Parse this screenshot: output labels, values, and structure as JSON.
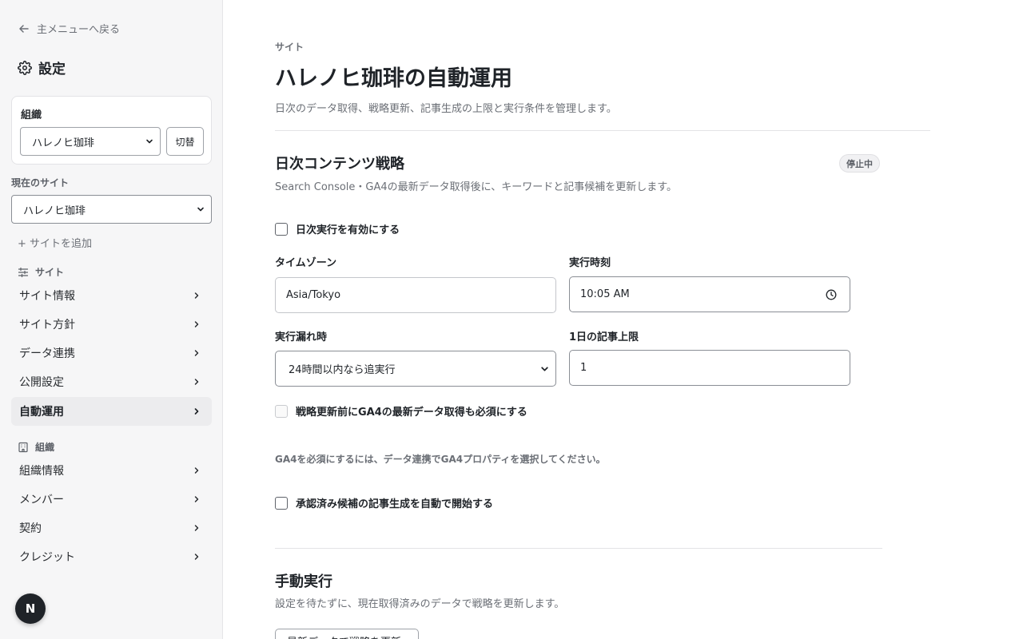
{
  "sidebar": {
    "back_label": "主メニューへ戻る",
    "settings_title": "設定",
    "org_label": "組織",
    "org_selected": "ハレノヒ珈琲",
    "switch_label": "切替",
    "current_site_label": "現在のサイト",
    "site_selected": "ハレノヒ珈琲",
    "add_site_label": "+ サイトを追加",
    "site_section_label": "サイト",
    "site_items": [
      {
        "label": "サイト情報"
      },
      {
        "label": "サイト方針"
      },
      {
        "label": "データ連携"
      },
      {
        "label": "公開設定"
      },
      {
        "label": "自動運用"
      }
    ],
    "org_section_label": "組織",
    "org_items": [
      {
        "label": "組織情報"
      },
      {
        "label": "メンバー"
      },
      {
        "label": "契約"
      },
      {
        "label": "クレジット"
      }
    ],
    "avatar_initial": "N"
  },
  "main": {
    "eyebrow": "サイト",
    "title": "ハレノヒ珈琲の自動運用",
    "description": "日次のデータ取得、戦略更新、記事生成の上限と実行条件を管理します。",
    "daily": {
      "title": "日次コンテンツ戦略",
      "description": "Search Console・GA4の最新データ取得後に、キーワードと記事候補を更新します。",
      "status_badge": "停止中",
      "enable_label": "日次実行を有効にする",
      "timezone_label": "タイムゾーン",
      "timezone_value": "Asia/Tokyo",
      "run_time_label": "実行時刻",
      "run_time_value": "10:05 AM",
      "missed_label": "実行漏れ時",
      "missed_value": "24時間以内なら追実行",
      "daily_limit_label": "1日の記事上限",
      "daily_limit_value": "1",
      "ga4_required_label": "戦略更新前にGA4の最新データ取得も必須にする",
      "ga4_hint": "GA4を必須にするには、データ連携でGA4プロパティを選択してください。",
      "auto_generate_label": "承認済み候補の記事生成を自動で開始する"
    },
    "manual": {
      "title": "手動実行",
      "description": "設定を待たずに、現在取得済みのデータで戦略を更新します。",
      "button_label": "最新データで戦略を更新"
    }
  },
  "colors": {
    "sidebar_bg": "#f6f6f7",
    "active_item_bg": "#ececee",
    "text_primary": "#1f2328",
    "text_muted": "#6b6f76"
  }
}
